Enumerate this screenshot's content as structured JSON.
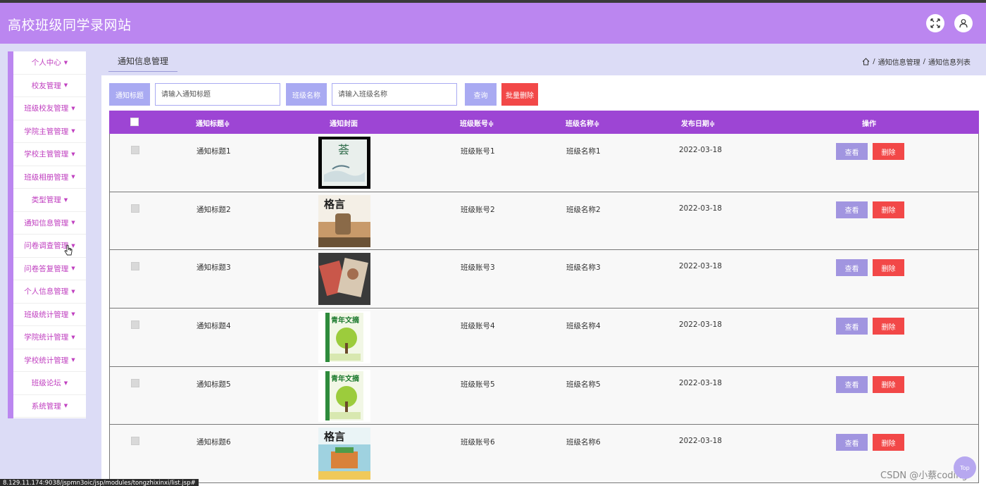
{
  "app": {
    "title": "高校班级同学录网站"
  },
  "sidebar": {
    "items": [
      {
        "label": "个人中心"
      },
      {
        "label": "校友管理"
      },
      {
        "label": "班级校友管理"
      },
      {
        "label": "学院主管管理"
      },
      {
        "label": "学校主管管理"
      },
      {
        "label": "班级相册管理"
      },
      {
        "label": "类型管理"
      },
      {
        "label": "通知信息管理"
      },
      {
        "label": "问卷调查管理"
      },
      {
        "label": "问卷答复管理"
      },
      {
        "label": "个人信息管理"
      },
      {
        "label": "班级统计管理"
      },
      {
        "label": "学院统计管理"
      },
      {
        "label": "学校统计管理"
      },
      {
        "label": "班级论坛"
      },
      {
        "label": "系统管理"
      }
    ],
    "caret": "▼"
  },
  "tab": {
    "label": "通知信息管理"
  },
  "breadcrumb": {
    "level1": "通知信息管理",
    "level2": "通知信息列表",
    "sep": "/"
  },
  "filter": {
    "title_label": "通知标题",
    "title_placeholder": "请输入通知标题",
    "class_label": "班级名称",
    "class_placeholder": "请输入班级名称",
    "search_button": "查询",
    "batch_delete_button": "批量删除"
  },
  "table": {
    "headers": {
      "title": "通知标题",
      "cover": "通知封面",
      "account": "班级账号",
      "classname": "班级名称",
      "date": "发布日期",
      "actions": "操作",
      "sort_icon": "≑"
    },
    "rows": [
      {
        "title": "通知标题1",
        "account": "班级账号1",
        "classname": "班级名称1",
        "date": "2022-03-18"
      },
      {
        "title": "通知标题2",
        "account": "班级账号2",
        "classname": "班级名称2",
        "date": "2022-03-18"
      },
      {
        "title": "通知标题3",
        "account": "班级账号3",
        "classname": "班级名称3",
        "date": "2022-03-18"
      },
      {
        "title": "通知标题4",
        "account": "班级账号4",
        "classname": "班级名称4",
        "date": "2022-03-18"
      },
      {
        "title": "通知标题5",
        "account": "班级账号5",
        "classname": "班级名称5",
        "date": "2022-03-18"
      },
      {
        "title": "通知标题6",
        "account": "班级账号6",
        "classname": "班级名称6",
        "date": "2022-03-18"
      }
    ],
    "view_button": "查看",
    "delete_button": "删除"
  },
  "covers": {
    "c1": {
      "text": "荟"
    },
    "c2": {
      "text": "格言"
    },
    "c4": {
      "text": "青年文摘"
    },
    "c5": {
      "text": "青年文摘"
    },
    "c6": {
      "text": "格言"
    }
  },
  "status": {
    "url": "8.129.11.174:9038/jspmn3oic/jsp/modules/tongzhixinxi/list.jsp#"
  },
  "watermark": {
    "text": "CSDN @小蔡coding"
  },
  "back_to_top": {
    "label": "Top"
  },
  "colors": {
    "header": "#bb86f0",
    "table_header": "#9d45d4",
    "label_bg": "#a9aaf2",
    "delete_red": "#f24848",
    "view_purple": "#a195e0",
    "page_bg": "#dcdcf6",
    "sidebar_text": "#c040c0"
  },
  "icons": {
    "fullscreen": "fullscreen-icon",
    "user": "user-icon",
    "home": "home-icon",
    "sort": "sort-icon",
    "caret": "caret-down-icon"
  }
}
